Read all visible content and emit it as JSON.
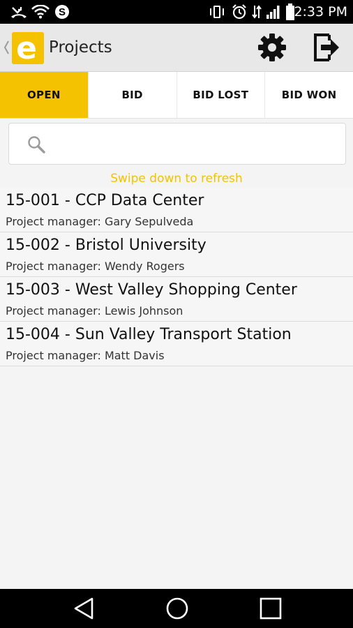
{
  "status_bar": {
    "time": "2:33 PM",
    "icons": [
      "missed-call-icon",
      "wifi-icon",
      "skype-icon",
      "vibrate-icon",
      "alarm-icon",
      "data-icon",
      "signal-icon",
      "battery-icon"
    ]
  },
  "app_bar": {
    "title": "Projects",
    "logo_letter": "e",
    "actions": [
      "settings-icon",
      "logout-icon"
    ]
  },
  "colors": {
    "accent": "#f5c200",
    "text": "#111111"
  },
  "tabs": [
    {
      "label": "OPEN",
      "active": true
    },
    {
      "label": "BID",
      "active": false
    },
    {
      "label": "BID LOST",
      "active": false
    },
    {
      "label": "BID WON",
      "active": false
    }
  ],
  "search": {
    "value": "",
    "placeholder": ""
  },
  "refresh_hint": "Swipe down to refresh",
  "projects": [
    {
      "title": "15-001 - CCP Data Center",
      "manager_line": "Project manager: Gary Sepulveda"
    },
    {
      "title": "15-002 - Bristol University",
      "manager_line": "Project manager: Wendy Rogers"
    },
    {
      "title": "15-003 - West Valley Shopping Center",
      "manager_line": "Project manager: Lewis Johnson"
    },
    {
      "title": "15-004 - Sun Valley Transport Station",
      "manager_line": "Project manager: Matt Davis"
    }
  ],
  "nav_bar": {
    "buttons": [
      "back-triangle-icon",
      "home-circle-icon",
      "recents-square-icon"
    ]
  }
}
